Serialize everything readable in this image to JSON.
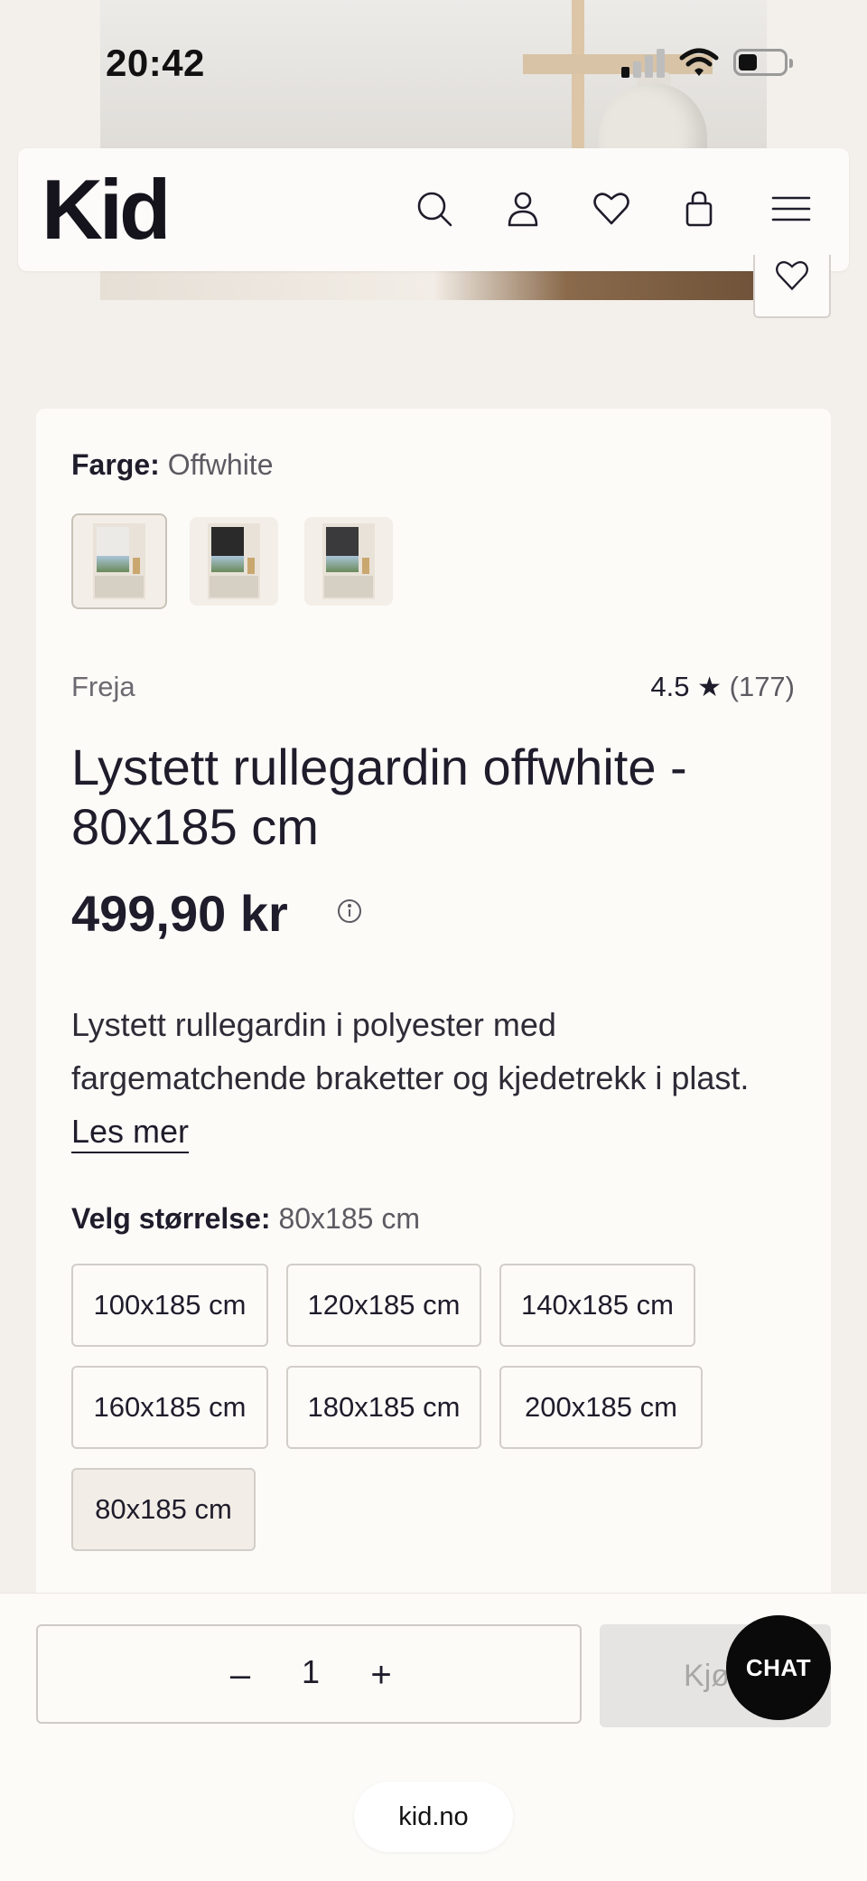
{
  "status_bar": {
    "time": "20:42"
  },
  "header": {
    "logo": "Kid",
    "icons": [
      "search-icon",
      "account-icon",
      "favorite-icon",
      "cart-icon",
      "menu-icon"
    ]
  },
  "product": {
    "color_label": "Farge:",
    "color_value": "Offwhite",
    "swatches": [
      "Offwhite",
      "Black",
      "Dark grey"
    ],
    "brand": "Freja",
    "rating_score": "4.5",
    "rating_star": "★",
    "rating_count": "(177)",
    "title": "Lystett rullegardin offwhite - 80x185 cm",
    "price": "499,90 kr",
    "description": "Lystett rullegardin i polyester med fargematchende braketter og kjedetrekk i plast.",
    "read_more": "Les mer",
    "size_label": "Velg størrelse:",
    "size_value": "80x185 cm",
    "sizes": [
      "100x185 cm",
      "120x185 cm",
      "140x185 cm",
      "160x185 cm",
      "180x185 cm",
      "200x185 cm",
      "80x185 cm"
    ],
    "selected_size": "80x185 cm"
  },
  "cart_bar": {
    "minus": "–",
    "quantity": "1",
    "plus": "+",
    "buy_label": "Kjøp",
    "chat_label": "CHAT"
  },
  "browser": {
    "url": "kid.no"
  },
  "colors": {
    "background": "#f3efea",
    "card": "#fcfbf8",
    "text": "#1f1c2b",
    "chat": "#0a0a0a"
  }
}
